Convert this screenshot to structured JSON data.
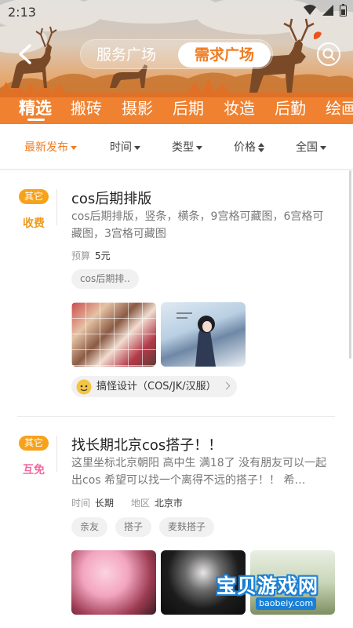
{
  "status_bar": {
    "time": "2:13"
  },
  "header": {
    "segments": [
      {
        "label": "服务广场"
      },
      {
        "label": "需求广场"
      }
    ],
    "tabs": [
      {
        "label": "精选"
      },
      {
        "label": "搬砖"
      },
      {
        "label": "摄影"
      },
      {
        "label": "后期"
      },
      {
        "label": "妆造"
      },
      {
        "label": "后勤"
      },
      {
        "label": "绘画"
      }
    ]
  },
  "filters": [
    {
      "label": "最新发布"
    },
    {
      "label": "时间"
    },
    {
      "label": "类型"
    },
    {
      "label": "价格"
    },
    {
      "label": "全国"
    }
  ],
  "posts": [
    {
      "category": "其它",
      "price_type": "收费",
      "title": "cos后期排版",
      "desc": "cos后期排版，竖条，横条，9宫格可藏图，6宫格可藏图，3宫格可藏图",
      "budget_label": "预算",
      "budget": "5元",
      "tags": [
        "cos后期排.."
      ],
      "studio": "搞怪设计（COS/JK/汉服）"
    },
    {
      "category": "其它",
      "price_type": "互免",
      "title": "找长期北京cos搭子！！",
      "desc": "这里坐标北京朝阳 高中生 满18了 没有朋友可以一起出cos 希望可以找一个离得不远的搭子！！ 希…",
      "time_label": "时间",
      "time": "长期",
      "area_label": "地区",
      "area": "北京市",
      "tags": [
        "亲友",
        "搭子",
        "麦麸搭子"
      ]
    }
  ],
  "watermark": {
    "title": "宝贝游戏网",
    "url": "baobeiy.com"
  },
  "colors": {
    "accent": "#f07d22",
    "badge": "#f7a21b",
    "pink": "#f06aa0"
  }
}
